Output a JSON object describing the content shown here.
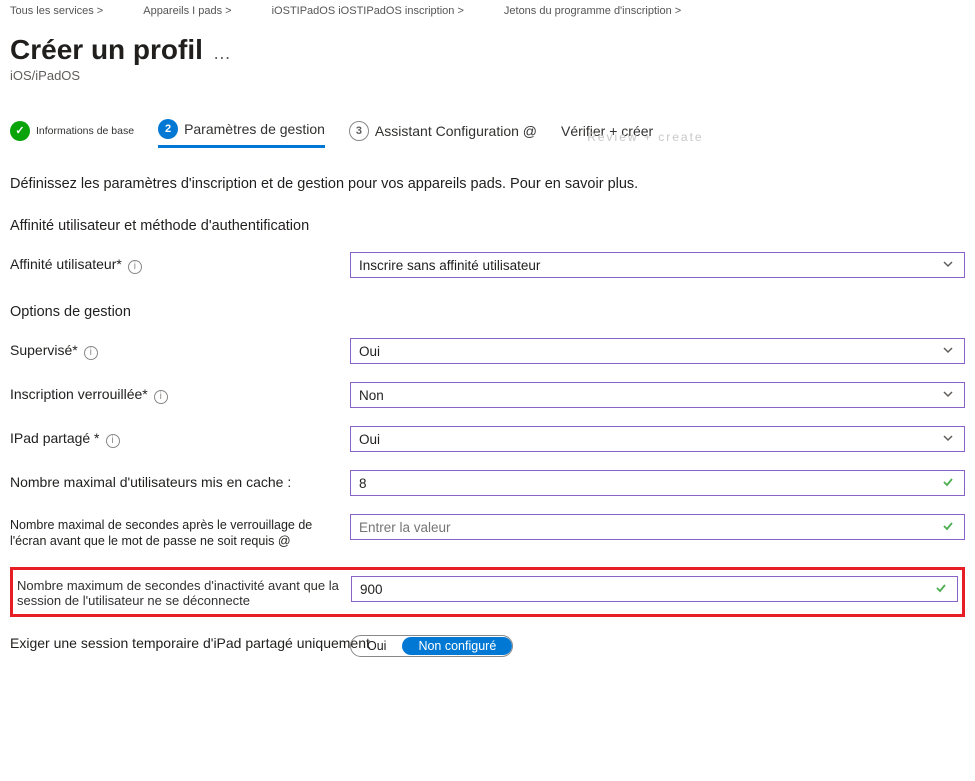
{
  "breadcrumbs": {
    "item1": "Tous les services >",
    "item2": "Appareils I pads >",
    "item3": "iOSTIPadOS iOSTIPadOS inscription >",
    "item4": "Jetons du programme d'inscription >"
  },
  "header": {
    "title": "Créer un profil",
    "subtitle": "iOS/iPadOS",
    "more": "…"
  },
  "wizard": {
    "step1": {
      "label": "Informations de base",
      "icon": "✓"
    },
    "step2": {
      "label": "Paramètres de gestion",
      "num": "2"
    },
    "step3": {
      "label": "Assistant Configuration @",
      "num": "3"
    },
    "step4": {
      "label": "Vérifier + créer"
    },
    "review_ghost": "Review + create"
  },
  "description": "Définissez les paramètres d'inscription et de gestion pour vos appareils pads. Pour en savoir plus.",
  "section_affinity_title": "Affinité utilisateur et méthode d'authentification",
  "affinity": {
    "label": "Affinité utilisateur*",
    "value": "Inscrire sans affinité utilisateur"
  },
  "section_options_title": "Options de gestion",
  "supervised": {
    "label": "Supervisé*",
    "value": "Oui"
  },
  "locked": {
    "label": "Inscription verrouillée*",
    "value": "Non"
  },
  "shared_ipad": {
    "label": "IPad partagé *",
    "value": "Oui"
  },
  "max_users": {
    "label": "Nombre maximal d'utilisateurs mis en cache :",
    "value": "8"
  },
  "max_sec_lock": {
    "label": "Nombre maximal de secondes après le verrouillage de l'écran avant que le mot de passe ne soit requis @",
    "placeholder": "Entrer la valeur"
  },
  "max_sec_inactivity": {
    "label": "Nombre maximum de secondes d'inactivité avant que la session de l'utilisateur ne se déconnecte",
    "value": "900"
  },
  "temp_session": {
    "label": "Exiger une session temporaire d'iPad partagé uniquement",
    "opt_yes": "Oui",
    "opt_no": "Non configuré"
  }
}
